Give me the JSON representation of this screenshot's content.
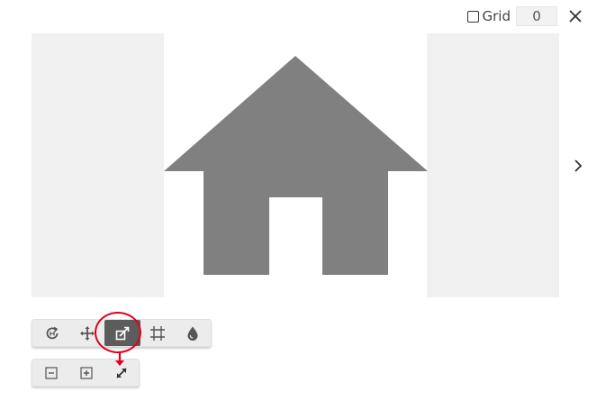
{
  "topbar": {
    "grid_label": "Grid",
    "grid_checked": false,
    "grid_value": "0",
    "close_icon": "close-icon"
  },
  "canvas": {
    "panel_color": "#f0f0f0",
    "shape_color": "#808080",
    "shape_icon": "house-shape"
  },
  "navigation": {
    "next_icon": "chevron-right-icon"
  },
  "toolbar_main": {
    "tools": [
      {
        "icon": "rotate-icon",
        "active": false
      },
      {
        "icon": "move-icon",
        "active": false
      },
      {
        "icon": "resize-edit-icon",
        "active": true
      },
      {
        "icon": "crop-grid-icon",
        "active": false
      },
      {
        "icon": "fill-drop-icon",
        "active": false
      }
    ]
  },
  "toolbar_sub": {
    "tools": [
      {
        "icon": "fit-minus-icon",
        "active": false
      },
      {
        "icon": "fit-plus-icon",
        "active": false
      },
      {
        "icon": "expand-diagonal-icon",
        "active": false
      }
    ]
  },
  "colors": {
    "accent_active": "#5c5c5c",
    "annotation": "#e2001a",
    "toolbar_bg": "#ececec"
  }
}
